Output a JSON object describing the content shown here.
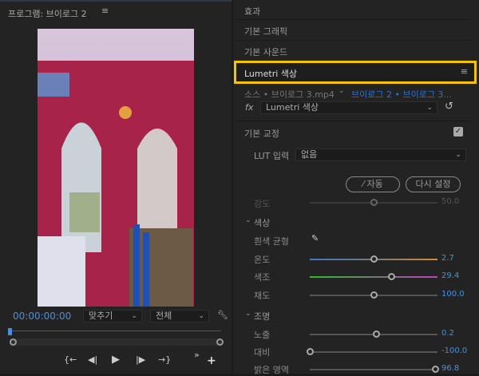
{
  "program": {
    "title": "프로그램: 브이로그 2",
    "menu_icon": "hamburger-icon",
    "timecode": "00:00:00:00",
    "fit": "맞추기",
    "quality": "전체",
    "wrench_icon": "wrench-icon",
    "transport": [
      "go-to-in-icon",
      "step-back-icon",
      "play-icon",
      "step-forward-icon",
      "go-to-out-icon"
    ],
    "more_icon": "double-chevron-icon",
    "add_icon": "plus-icon"
  },
  "panel": {
    "tabs": [
      "효과",
      "기본 그래픽",
      "기본 사운드"
    ],
    "active": "Lumetri 색상",
    "highlight_color": "#f5c400",
    "source": "소스 • 브이로그 3.mp4",
    "sequence": "브이로그 2 • 브이로그 3...",
    "fx_label": "fx",
    "effect": "Lumetri 색상",
    "basic": {
      "title": "기본 교정",
      "checked": true,
      "lut_label": "LUT 입력",
      "lut_value": "없음",
      "auto": "자동",
      "reset": "다시 설정",
      "intensity": {
        "label": "강도",
        "value": "50.0",
        "pos": 0.5
      }
    },
    "color": {
      "title": "색상",
      "wb": "흰색 균형",
      "sliders": [
        {
          "label": "온도",
          "value": "2.7",
          "pos": 0.5
        },
        {
          "label": "색조",
          "value": "29.4",
          "pos": 0.64
        },
        {
          "label": "채도",
          "value": "100.0",
          "pos": 0.5
        }
      ]
    },
    "light": {
      "title": "조명",
      "sliders": [
        {
          "label": "노출",
          "value": "0.2",
          "pos": 0.52
        },
        {
          "label": "대비",
          "value": "-100.0",
          "pos": 0.0
        },
        {
          "label": "밝은 영역",
          "value": "96.8",
          "pos": 0.98
        }
      ]
    }
  }
}
